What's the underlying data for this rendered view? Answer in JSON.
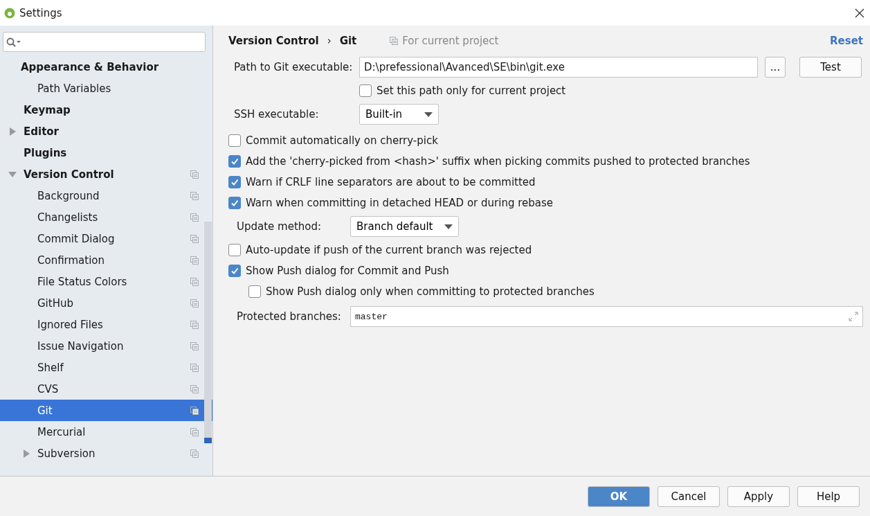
{
  "window": {
    "title": "Settings"
  },
  "sidebar": {
    "items": [
      {
        "kind": "header",
        "label": "Appearance & Behavior",
        "selected": false,
        "project": false,
        "children": [
          {
            "kind": "leaf",
            "label": "Path Variables",
            "selected": false,
            "project": false
          }
        ]
      },
      {
        "kind": "leaf",
        "label": "Keymap",
        "selected": false,
        "project": false
      },
      {
        "kind": "group",
        "label": "Editor",
        "expanded": false,
        "selected": false,
        "project": false
      },
      {
        "kind": "leaf",
        "label": "Plugins",
        "selected": false,
        "project": false
      },
      {
        "kind": "group",
        "label": "Version Control",
        "expanded": true,
        "selected": false,
        "project": true,
        "children": [
          {
            "kind": "leaf",
            "label": "Background",
            "selected": false,
            "project": true
          },
          {
            "kind": "leaf",
            "label": "Changelists",
            "selected": false,
            "project": true
          },
          {
            "kind": "leaf",
            "label": "Commit Dialog",
            "selected": false,
            "project": true
          },
          {
            "kind": "leaf",
            "label": "Confirmation",
            "selected": false,
            "project": true
          },
          {
            "kind": "leaf",
            "label": "File Status Colors",
            "selected": false,
            "project": true
          },
          {
            "kind": "leaf",
            "label": "GitHub",
            "selected": false,
            "project": true
          },
          {
            "kind": "leaf",
            "label": "Ignored Files",
            "selected": false,
            "project": true
          },
          {
            "kind": "leaf",
            "label": "Issue Navigation",
            "selected": false,
            "project": true
          },
          {
            "kind": "leaf",
            "label": "Shelf",
            "selected": false,
            "project": true
          },
          {
            "kind": "leaf",
            "label": "CVS",
            "selected": false,
            "project": true
          },
          {
            "kind": "leaf",
            "label": "Git",
            "selected": true,
            "project": true
          },
          {
            "kind": "leaf",
            "label": "Mercurial",
            "selected": false,
            "project": true
          },
          {
            "kind": "group",
            "label": "Subversion",
            "expanded": false,
            "selected": false,
            "project": true
          }
        ]
      }
    ]
  },
  "breadcrumb": {
    "parent": "Version Control",
    "separator": "›",
    "current": "Git",
    "scope": "For current project",
    "reset": "Reset"
  },
  "git_section": [
    {
      "kind": "path",
      "label": "Path to Git executable:",
      "value": "D:\\prefessional\\Avanced\\SE\\bin\\git.exe",
      "browse": "...",
      "test": "Test"
    },
    {
      "kind": "checkbox",
      "label": "Set this path only for current project",
      "checked": false
    },
    {
      "kind": "select",
      "label": "SSH executable:",
      "value": "Built-in"
    }
  ],
  "options": [
    {
      "kind": "checkbox",
      "label": "Commit automatically on cherry-pick",
      "checked": false
    },
    {
      "kind": "checkbox",
      "label": "Add the 'cherry-picked from <hash>' suffix when picking commits pushed to protected branches",
      "checked": true
    },
    {
      "kind": "checkbox",
      "label": "Warn if CRLF line separators are about to be committed",
      "checked": true
    },
    {
      "kind": "checkbox",
      "label": "Warn when committing in detached HEAD or during rebase",
      "checked": true
    },
    {
      "kind": "select",
      "label": "Update method:",
      "value": "Branch default"
    },
    {
      "kind": "checkbox",
      "label": "Auto-update if push of the current branch was rejected",
      "checked": false
    },
    {
      "kind": "checkbox",
      "label": "Show Push dialog for Commit and Push",
      "checked": true
    },
    {
      "kind": "sub-checkbox",
      "label": "Show Push dialog only when committing to protected branches",
      "checked": false
    },
    {
      "kind": "text",
      "label": "Protected branches:",
      "value": "master"
    }
  ],
  "buttons": [
    {
      "label": "OK",
      "primary": true
    },
    {
      "label": "Cancel",
      "primary": false
    },
    {
      "label": "Apply",
      "primary": false
    },
    {
      "label": "Help",
      "primary": false
    }
  ]
}
